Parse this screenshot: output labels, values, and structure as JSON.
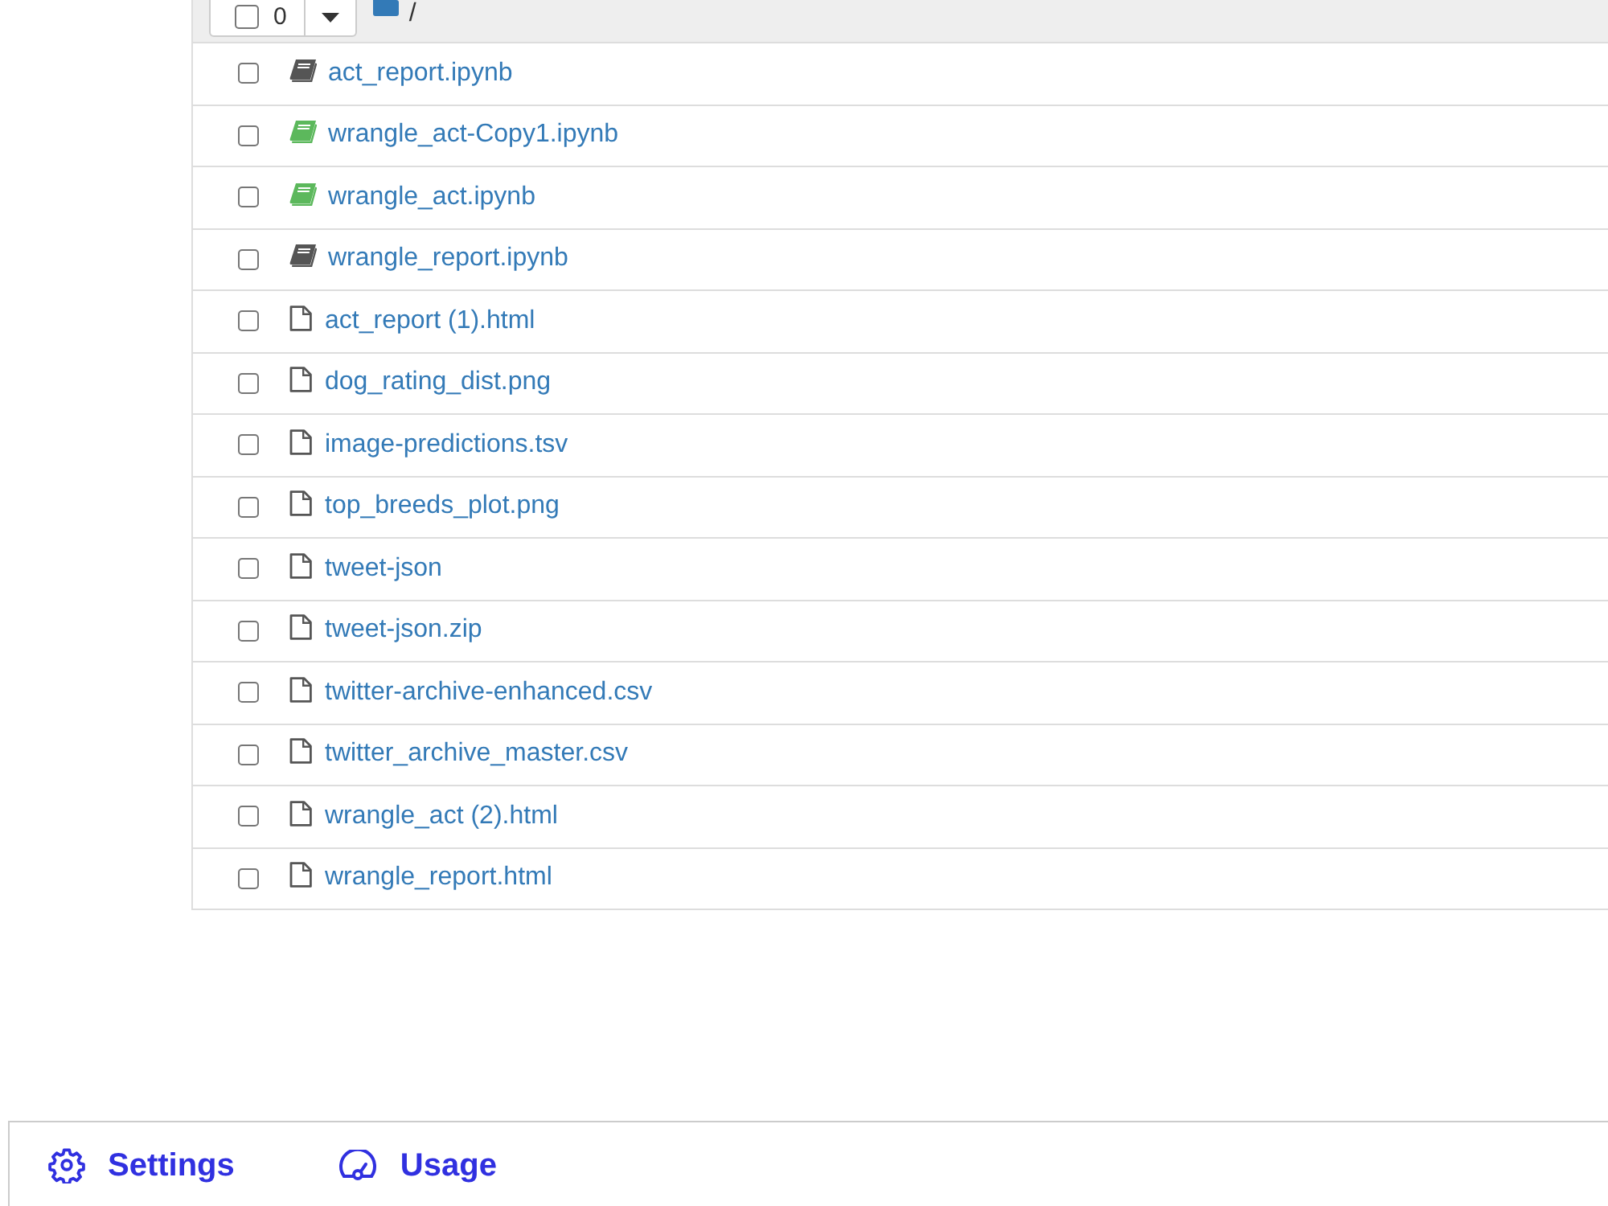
{
  "toolbar": {
    "select_all": {
      "checked": false
    },
    "selected_count": "0",
    "breadcrumb": "/"
  },
  "files": [
    {
      "kind": "notebook",
      "running": false,
      "name": "act_report.ipynb",
      "checked": false
    },
    {
      "kind": "notebook",
      "running": true,
      "name": "wrangle_act-Copy1.ipynb",
      "checked": false
    },
    {
      "kind": "notebook",
      "running": true,
      "name": "wrangle_act.ipynb",
      "checked": false
    },
    {
      "kind": "notebook",
      "running": false,
      "name": "wrangle_report.ipynb",
      "checked": false
    },
    {
      "kind": "file",
      "name": "act_report (1).html",
      "checked": false
    },
    {
      "kind": "file",
      "name": "dog_rating_dist.png",
      "checked": false
    },
    {
      "kind": "file",
      "name": "image-predictions.tsv",
      "checked": false
    },
    {
      "kind": "file",
      "name": "top_breeds_plot.png",
      "checked": false
    },
    {
      "kind": "file",
      "name": "tweet-json",
      "checked": false
    },
    {
      "kind": "file",
      "name": "tweet-json.zip",
      "checked": false
    },
    {
      "kind": "file",
      "name": "twitter-archive-enhanced.csv",
      "checked": false
    },
    {
      "kind": "file",
      "name": "twitter_archive_master.csv",
      "checked": false
    },
    {
      "kind": "file",
      "name": "wrangle_act (2).html",
      "checked": false
    },
    {
      "kind": "file",
      "name": "wrangle_report.html",
      "checked": false
    }
  ],
  "footer": {
    "links": [
      {
        "kind": "settings",
        "label": "Settings"
      },
      {
        "kind": "usage",
        "label": "Usage"
      }
    ]
  }
}
